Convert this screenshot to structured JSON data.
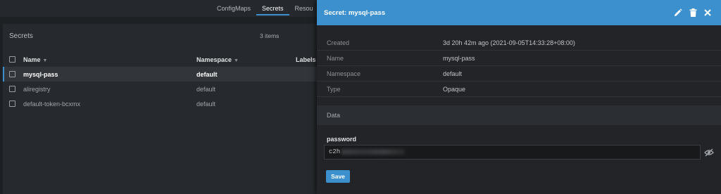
{
  "tabs": [
    {
      "label": "ConfigMaps"
    },
    {
      "label": "Secrets"
    },
    {
      "label": "Resou"
    }
  ],
  "list": {
    "title": "Secrets",
    "count": "3 items",
    "columns": {
      "name": "Name",
      "namespace": "Namespace",
      "labels": "Labels"
    },
    "rows": [
      {
        "name": "mysql-pass",
        "namespace": "default",
        "selected": true
      },
      {
        "name": "aliregistry",
        "namespace": "default",
        "selected": false
      },
      {
        "name": "default-token-bcxmx",
        "namespace": "default",
        "selected": false
      }
    ]
  },
  "drawer": {
    "title": "Secret: mysql-pass",
    "icons": [
      "pencil-icon",
      "trash-icon",
      "close-icon"
    ],
    "details": [
      {
        "key": "Created",
        "value": "3d 20h 42m ago (2021-09-05T14:33:28+08:00)"
      },
      {
        "key": "Name",
        "value": "mysql-pass"
      },
      {
        "key": "Namespace",
        "value": "default"
      },
      {
        "key": "Type",
        "value": "Opaque"
      }
    ],
    "data_section": "Data",
    "field_label": "password",
    "field_value": "c2h",
    "save_label": "Save"
  },
  "colors": {
    "accent": "#3d90ce",
    "background": "#1e2124",
    "panel": "#26292d"
  }
}
